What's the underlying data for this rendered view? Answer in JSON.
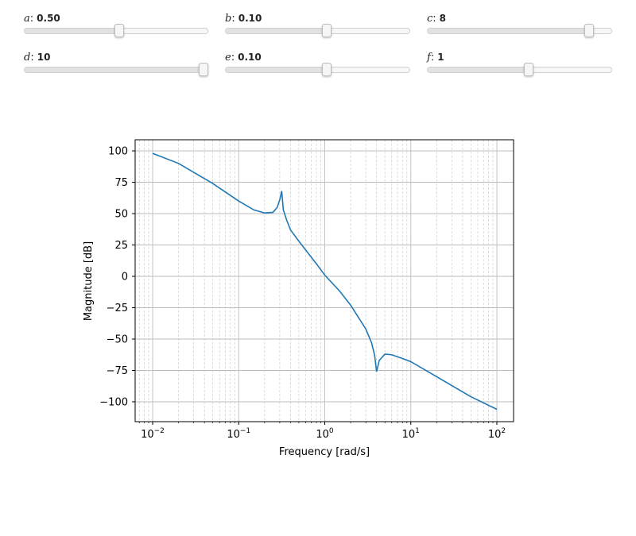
{
  "sliders": [
    {
      "symbol": "a",
      "value_text": "0.50",
      "fraction": 0.52
    },
    {
      "symbol": "b",
      "value_text": "0.10",
      "fraction": 0.55
    },
    {
      "symbol": "c",
      "value_text": "8",
      "fraction": 0.895
    },
    {
      "symbol": "d",
      "value_text": "10",
      "fraction": 1.0
    },
    {
      "symbol": "e",
      "value_text": "0.10",
      "fraction": 0.55
    },
    {
      "symbol": "f",
      "value_text": "1",
      "fraction": 0.55
    }
  ],
  "chart_data": {
    "type": "line",
    "xlabel": "Frequency [rad/s]",
    "ylabel": "Magnitude [dB]",
    "x_scale": "log",
    "xlim": [
      0.01,
      100
    ],
    "ylim": [
      -100,
      100
    ],
    "x_tick_labels": [
      "10^-2",
      "10^-1",
      "10^0",
      "10^1",
      "10^2"
    ],
    "y_ticks": [
      100,
      75,
      50,
      25,
      0,
      -25,
      -50,
      -75,
      -100
    ],
    "grid": true,
    "line_color": "#1f77b4",
    "series": [
      {
        "x": [
          0.01,
          0.02,
          0.05,
          0.1,
          0.15,
          0.2,
          0.25,
          0.28,
          0.3,
          0.316,
          0.33,
          0.36,
          0.4,
          0.5,
          0.6,
          0.8,
          1,
          1.5,
          2,
          3,
          3.5,
          3.8,
          4.0,
          4.3,
          5,
          6,
          8,
          10,
          20,
          50,
          100
        ],
        "y": [
          98,
          90,
          74,
          60,
          53,
          50.5,
          51,
          55,
          61,
          68,
          53,
          45,
          37,
          28,
          21,
          10,
          1,
          -12,
          -23,
          -42,
          -53,
          -63,
          -76,
          -67,
          -62,
          -62.5,
          -65.5,
          -68,
          -80,
          -96,
          -106
        ]
      }
    ]
  }
}
